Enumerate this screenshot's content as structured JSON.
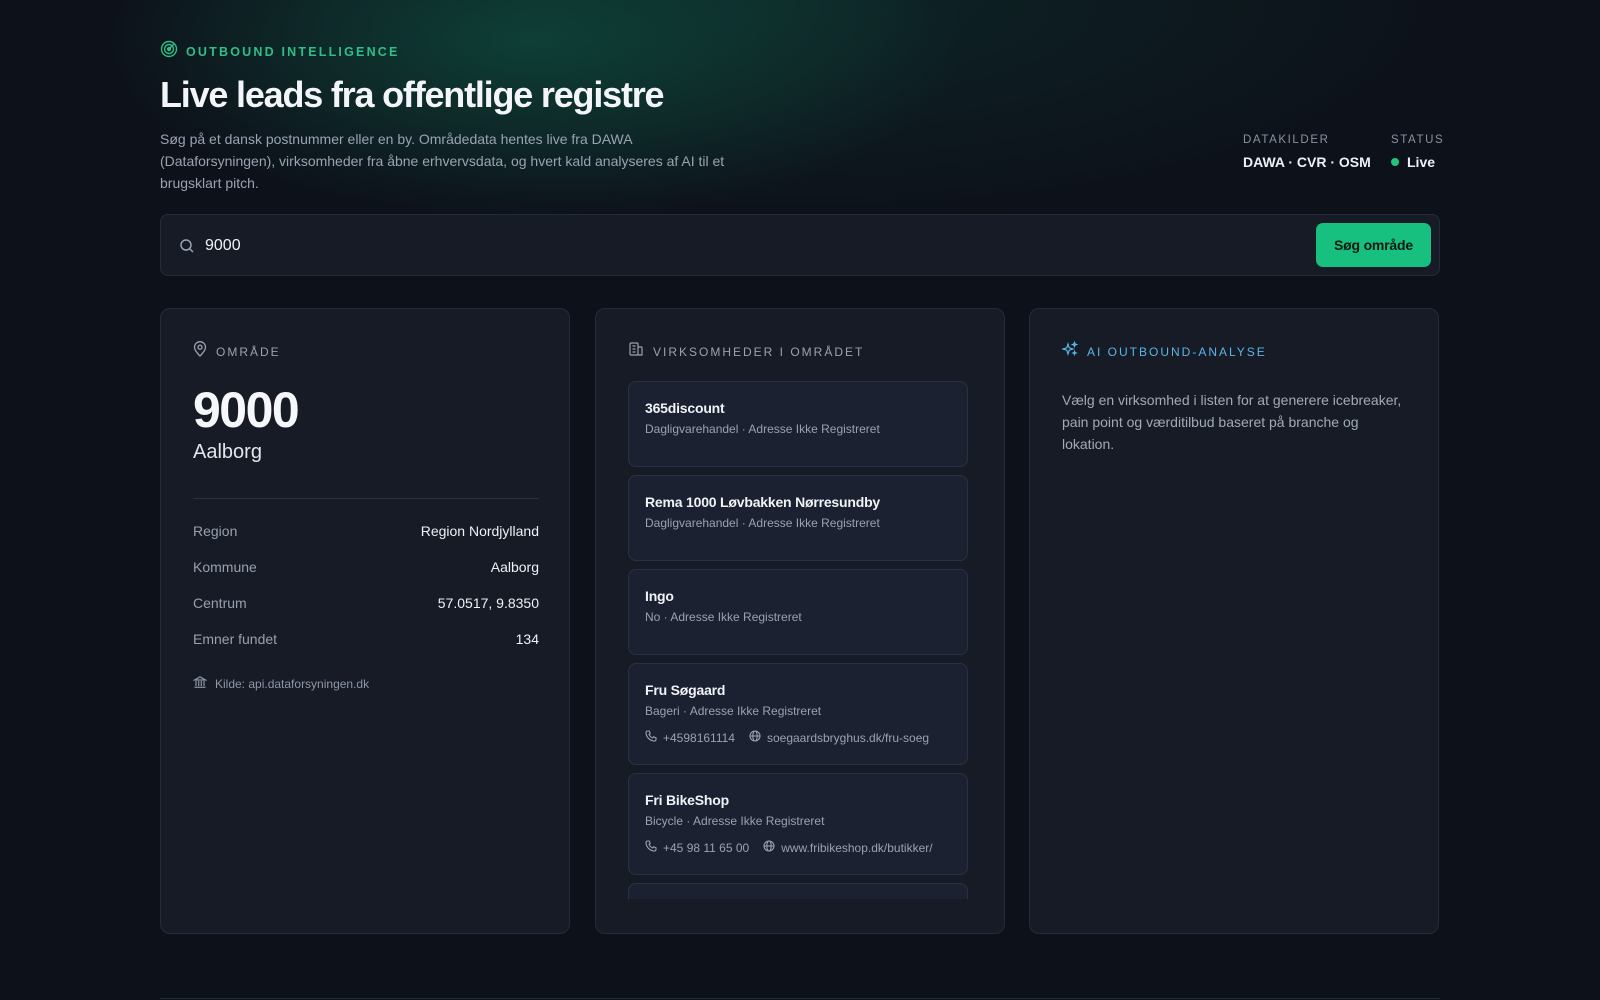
{
  "header": {
    "eyebrow": "OUTBOUND INTELLIGENCE",
    "title": "Live leads fra offentlige registre",
    "lead": "Søg på et dansk postnummer eller en by. Områdedata hentes live fra DAWA (Dataforsyningen), virksomheder fra åbne erhvervsdata, og hvert kald analyseres af AI til et brugsklart pitch.",
    "sources_label": "DATAKILDER",
    "sources_value": "DAWA · CVR · OSM",
    "status_label": "STATUS",
    "status_value": "Live"
  },
  "search": {
    "value": "9000",
    "button_label": "Søg område"
  },
  "area": {
    "heading": "OMRÅDE",
    "postal_code": "9000",
    "city": "Aalborg",
    "rows": [
      {
        "label": "Region",
        "value": "Region Nordjylland"
      },
      {
        "label": "Kommune",
        "value": "Aalborg"
      },
      {
        "label": "Centrum",
        "value": "57.0517, 9.8350"
      },
      {
        "label": "Emner fundet",
        "value": "134"
      }
    ],
    "source": "Kilde: api.dataforsyningen.dk"
  },
  "businesses": {
    "heading": "VIRKSOMHEDER I OMRÅDET",
    "items": [
      {
        "name": "365discount",
        "sub": "Dagligvarehandel · Adresse Ikke Registreret"
      },
      {
        "name": "Rema 1000 Løvbakken Nørresundby",
        "sub": "Dagligvarehandel · Adresse Ikke Registreret"
      },
      {
        "name": "Ingo",
        "sub": "No · Adresse Ikke Registreret"
      },
      {
        "name": "Fru Søgaard",
        "sub": "Bageri · Adresse Ikke Registreret",
        "phone": "+4598161114",
        "web": "soegaardsbryghus.dk/fru-soeg"
      },
      {
        "name": "Fri BikeShop",
        "sub": "Bicycle · Adresse Ikke Registreret",
        "phone": "+45 98 11 65 00",
        "web": "www.fribikeshop.dk/butikker/"
      }
    ]
  },
  "ai": {
    "heading": "AI OUTBOUND-ANALYSE",
    "text": "Vælg en virksomhed i listen for at generere icebreaker, pain point og værditilbud baseret på branche og lokation."
  },
  "colors": {
    "accent": "#17c07f",
    "ai_accent": "#5bb6e6",
    "background": "#0d1119",
    "card": "#161b26"
  },
  "icons": [
    "radar-icon",
    "search-icon",
    "map-pin-icon",
    "building-icon",
    "sparkles-icon",
    "bank-icon",
    "phone-icon",
    "globe-icon"
  ]
}
